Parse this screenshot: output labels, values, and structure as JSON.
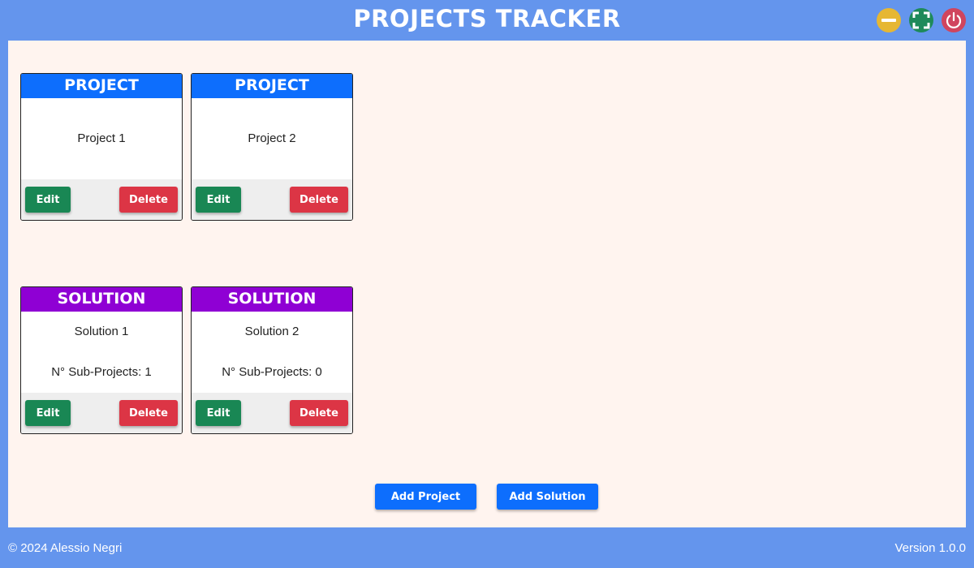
{
  "app": {
    "title": "PROJECTS TRACKER",
    "background_color": "#6495ed",
    "content_background": "#fff4ef"
  },
  "window_controls": [
    {
      "name": "minimize",
      "icon": "minus-icon",
      "color": "#e6b733"
    },
    {
      "name": "maximize",
      "icon": "fullscreen-icon",
      "color": "#1e8a5a"
    },
    {
      "name": "close",
      "icon": "power-icon",
      "color": "#d0455e"
    }
  ],
  "projects": [
    {
      "header": "PROJECT",
      "name": "Project 1",
      "edit_label": "Edit",
      "delete_label": "Delete"
    },
    {
      "header": "PROJECT",
      "name": "Project 2",
      "edit_label": "Edit",
      "delete_label": "Delete"
    }
  ],
  "solutions": [
    {
      "header": "SOLUTION",
      "name": "Solution 1",
      "subprojects": "N° Sub-Projects: 1",
      "edit_label": "Edit",
      "delete_label": "Delete"
    },
    {
      "header": "SOLUTION",
      "name": "Solution 2",
      "subprojects": "N° Sub-Projects: 0",
      "edit_label": "Edit",
      "delete_label": "Delete"
    }
  ],
  "colors": {
    "project_header": "#0d6efd",
    "solution_header": "#8f00d4",
    "edit_button": "#198754",
    "delete_button": "#dc3545",
    "add_button": "#0d6efd"
  },
  "actions": {
    "add_project_label": "Add Project",
    "add_solution_label": "Add Solution"
  },
  "footer": {
    "copyright": "© 2024 Alessio Negri",
    "version": "Version 1.0.0"
  }
}
